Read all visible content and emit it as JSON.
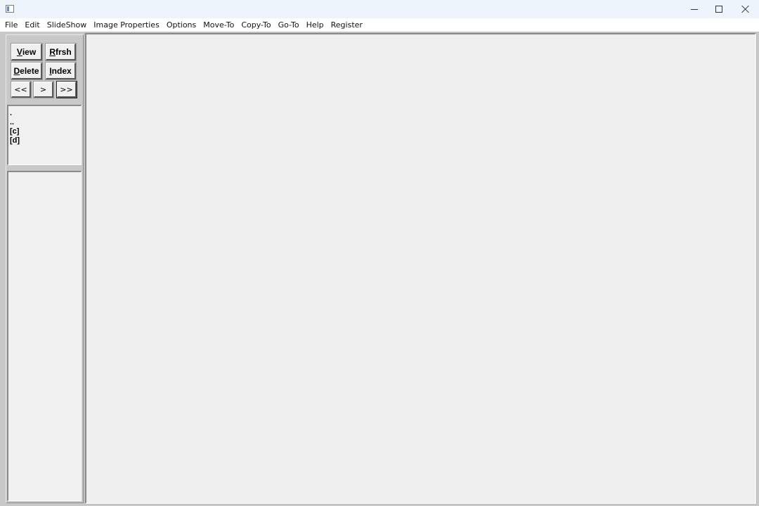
{
  "window": {
    "title": "",
    "icon": "app-window-icon",
    "controls": {
      "minimize": "minimize-icon",
      "maximize": "maximize-icon",
      "close": "close-icon"
    }
  },
  "menu": [
    "File",
    "Edit",
    "SlideShow",
    "Image Properties",
    "Options",
    "Move-To",
    "Copy-To",
    "Go-To",
    "Help",
    "Register"
  ],
  "toolbar": {
    "view": {
      "underline": "V",
      "rest": "iew"
    },
    "refresh": {
      "underline": "R",
      "rest": "frsh"
    },
    "delete": {
      "underline": "D",
      "rest": "elete"
    },
    "index": {
      "underline": "I",
      "rest": "ndex"
    },
    "first": "<<",
    "next": ">",
    "last": ">>"
  },
  "directory_list": [
    ".",
    "..",
    "[c]",
    "[d]"
  ],
  "file_list": [],
  "colors": {
    "panel": "#c8c8c8",
    "list_bg": "#f0f0f0",
    "image_bg": "#efefef",
    "titlebar": "#eef4fb"
  }
}
